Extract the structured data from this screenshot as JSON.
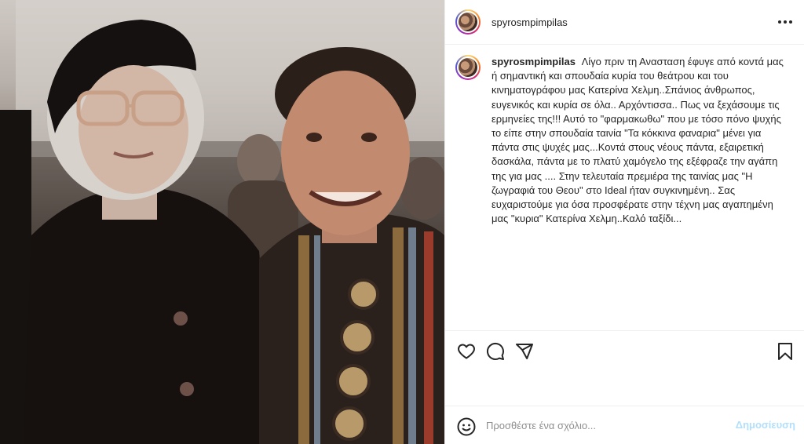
{
  "header": {
    "username": "spyrosmpimpilas",
    "more_icon": "more-horizontal-icon"
  },
  "caption": {
    "username": "spyrosmpimpilas",
    "text": "Λίγο πριν τη Ανασταση έφυγε από κοντά μας ή σημαντική και σπουδαία κυρία του θεάτρου και του κινηματογράφου μας Κατερίνα Χελμη..Σπάνιος άνθρωπος, ευγενικός και κυρία σε όλα.. Αρχόντισσα.. Πως να ξεχάσουμε τις ερμηνείες της!!! Αυτό το \"φαρμακωθω\" που με τόσο πόνο ψυχής το είπε στην σπουδαία ταινία \"Τα κόκκινα φαναρια\" μένει για πάντα στις ψυχές μας...Κοντά στους νέους πάντα, εξαιρετική δασκάλα, πάντα με το πλατύ χαμόγελο της εξέφραζε την αγάπη της για μας .... Στην τελευταία πρεμιέρα της ταινίας μας \"Η ζωγραφιά του Θεου\" στο Ideal ήταν συγκινημένη.. Σας ευχαριστούμε για όσα προσφέρατε στην τέχνη μας αγαπημένη μας \"κυρια\" Κατερίνα Χελμη..Καλό ταξίδι..."
  },
  "actions": {
    "like_icon": "heart-icon",
    "comment_icon": "comment-icon",
    "share_icon": "send-icon",
    "save_icon": "bookmark-icon"
  },
  "comment": {
    "placeholder": "Προσθέστε ένα σχόλιο...",
    "post_label": "Δημοσίευση",
    "emoji_icon": "emoji-icon"
  },
  "colors": {
    "text": "#262626",
    "muted": "#8e8e8e",
    "post_disabled": "#b2dffc",
    "divider": "#efefef"
  }
}
